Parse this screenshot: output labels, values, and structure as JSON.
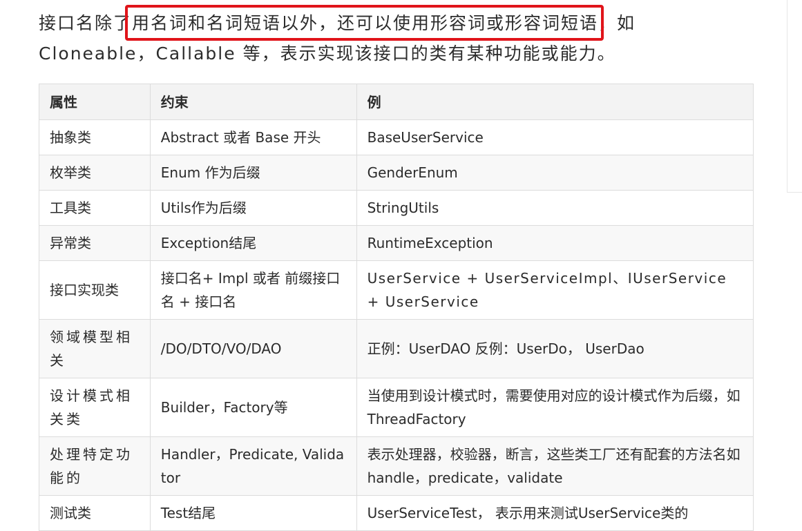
{
  "intro": {
    "line1_before": "接口名除了",
    "line1_highlight": "用名词和名词短语以外，还可以使用形容词或形容词短语",
    "line1_after": "，如",
    "line2": "Cloneable，Callable 等，表示实现该接口的类有某种功能或能力。"
  },
  "table": {
    "headers": [
      "属性",
      "约束",
      "例"
    ],
    "rows": [
      [
        "抽象类",
        "Abstract 或者 Base 开头",
        "BaseUserService"
      ],
      [
        "枚举类",
        "Enum 作为后缀",
        "GenderEnum"
      ],
      [
        "工具类",
        "Utils作为后缀",
        "StringUtils"
      ],
      [
        "异常类",
        "Exception结尾",
        "RuntimeException"
      ],
      [
        "接口实现类",
        "接口名+ Impl 或者 前缀接口名 + 接口名",
        "UserService + UserServiceImpl、IUserService + UserService"
      ],
      [
        "领域模型相关",
        "/DO/DTO/VO/DAO",
        "正例：UserDAO 反例：UserDo， UserDao"
      ],
      [
        "设计模式相关类",
        "Builder，Factory等",
        "当使用到设计模式时，需要使用对应的设计模式作为后缀，如ThreadFactory"
      ],
      [
        "处理特定功能的",
        "Handler，Predicate, Validator",
        "表示处理器，校验器，断言，这些类工厂还有配套的方法名如handle，predicate，validate"
      ],
      [
        "测试类",
        "Test结尾",
        "UserServiceTest， 表示用来测试UserService类的"
      ]
    ]
  }
}
